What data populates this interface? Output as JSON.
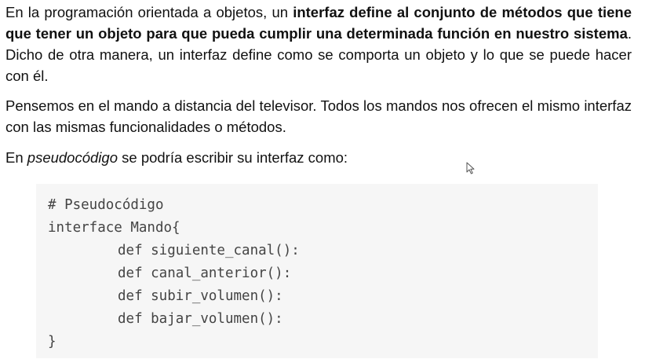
{
  "paragraphs": {
    "p1": {
      "a": "En la programación orientada a objetos, un ",
      "b": "interfaz define al conjunto de métodos que tiene que tener un objeto para que pueda cumplir una determinada función en nuestro sistema",
      "c": ". Dicho de otra manera, un interfaz define como se comporta un objeto y lo que se puede hacer con él."
    },
    "p2": "Pensemos en el mando a distancia del televisor. Todos los mandos nos ofrecen el mismo interfaz con las mismas funcionalidades o métodos.",
    "p3": {
      "a": "En ",
      "b": "pseudocódigo",
      "c": " se podría escribir su interfaz como:"
    }
  },
  "code": {
    "lines": [
      "# Pseudocódigo",
      "interface Mando{",
      "def siguiente_canal():",
      "def canal_anterior():",
      "def subir_volumen():",
      "def bajar_volumen():",
      "}"
    ]
  },
  "cursor": {
    "icon": "mouse-pointer-icon"
  }
}
